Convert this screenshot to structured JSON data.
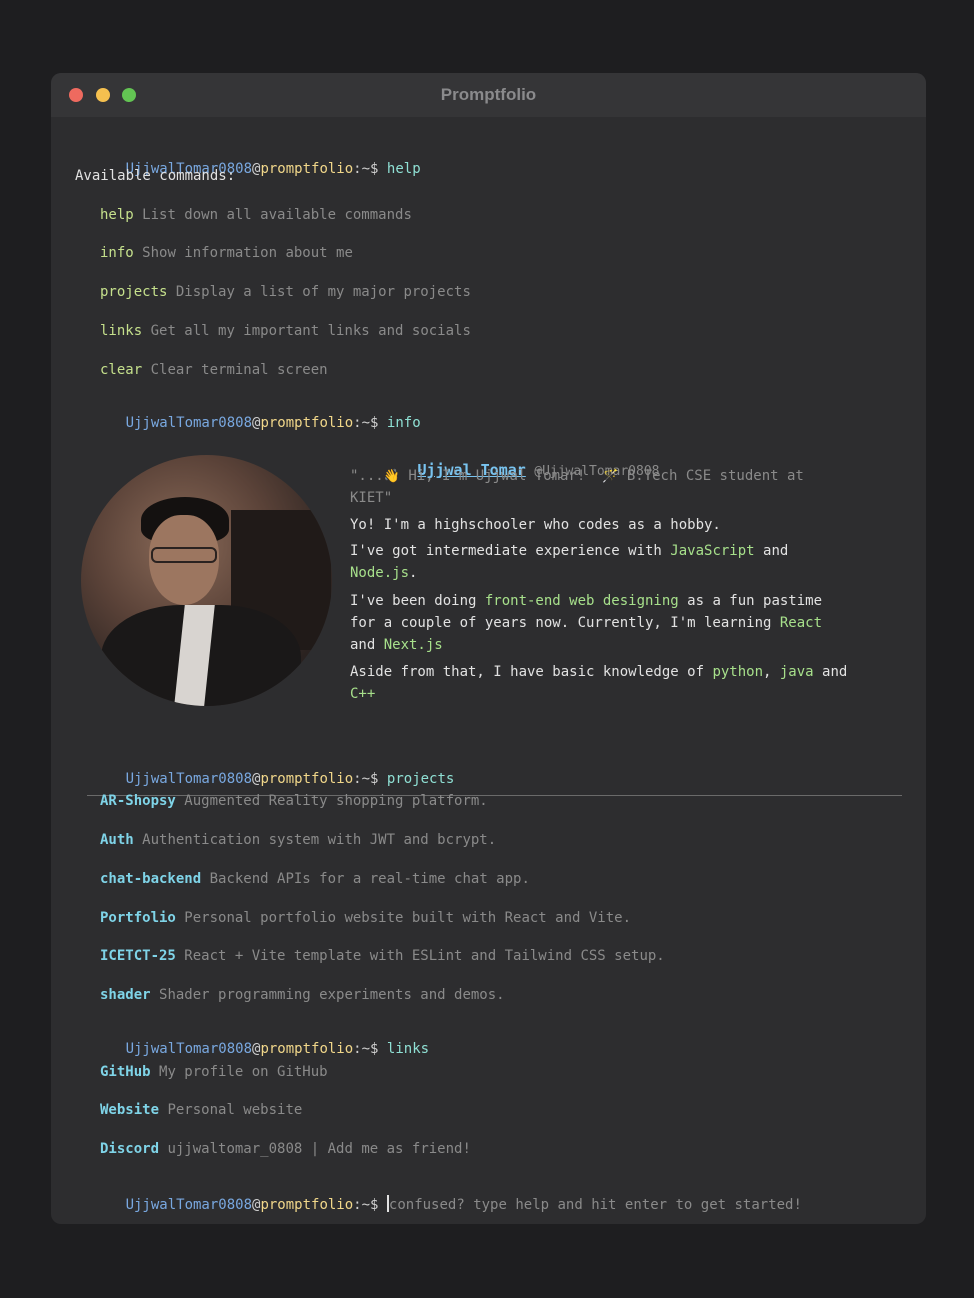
{
  "window": {
    "title": "Promptfolio"
  },
  "prompt": {
    "user": "UjjwalTomar0808",
    "at": "@",
    "host": "promptfolio",
    "path": ":~$"
  },
  "help": {
    "command": "help",
    "heading": "Available commands:",
    "commands": [
      {
        "name": "help",
        "desc": "List down all available commands"
      },
      {
        "name": "info",
        "desc": "Show information about me"
      },
      {
        "name": "projects",
        "desc": "Display a list of my major projects"
      },
      {
        "name": "links",
        "desc": "Get all my important links and socials"
      },
      {
        "name": "clear",
        "desc": "Clear terminal screen"
      }
    ]
  },
  "info": {
    "command": "info",
    "name": "Ujjwal Tomar",
    "handle": "@UjjwalTomar0808",
    "bio_open": "\"...",
    "bio_wave": "👋",
    "bio_text": "Hi, I'm Ujjwal Tomar!",
    "bio_wand": "🪄",
    "bio_rest": "B.Tech CSE student at",
    "bio_line2": "KIET\"",
    "p1": "Yo! I'm a highschooler who codes as a hobby.",
    "p2a": "I've got intermediate experience with ",
    "p2_js": "JavaScript",
    "p2b": " and",
    "p2_node": "Node.js",
    "p2c": ".",
    "p3a": "I've been doing ",
    "p3_fe": "front-end web designing",
    "p3b": " as a fun pastime",
    "p3c": "for a couple of years now. Currently, I'm learning ",
    "p3_react": "React",
    "p3d": "and ",
    "p3_next": "Next.js",
    "p4a": "Aside from that, I have basic knowledge of ",
    "p4_py": "python",
    "p4b": ", ",
    "p4_java": "java",
    "p4c": " and",
    "p4_cpp": "C++"
  },
  "projects": {
    "command": "projects",
    "items": [
      {
        "name": "AR-Shopsy",
        "desc": "Augmented Reality shopping platform."
      },
      {
        "name": "Auth",
        "desc": "Authentication system with JWT and bcrypt."
      },
      {
        "name": "chat-backend",
        "desc": "Backend APIs for a real-time chat app."
      },
      {
        "name": "Portfolio",
        "desc": "Personal portfolio website built with React and Vite."
      },
      {
        "name": "ICETCT-25",
        "desc": "React + Vite template with ESLint and Tailwind CSS setup."
      },
      {
        "name": "shader",
        "desc": "Shader programming experiments and demos."
      }
    ]
  },
  "links": {
    "command": "links",
    "items": [
      {
        "name": "GitHub",
        "desc": "My profile on GitHub"
      },
      {
        "name": "Website",
        "desc": "Personal website"
      },
      {
        "name": "Discord",
        "desc": "ujjwaltomar_0808 | Add me as friend!"
      }
    ]
  },
  "input": {
    "placeholder": "confused? type help and hit enter to get started!"
  }
}
